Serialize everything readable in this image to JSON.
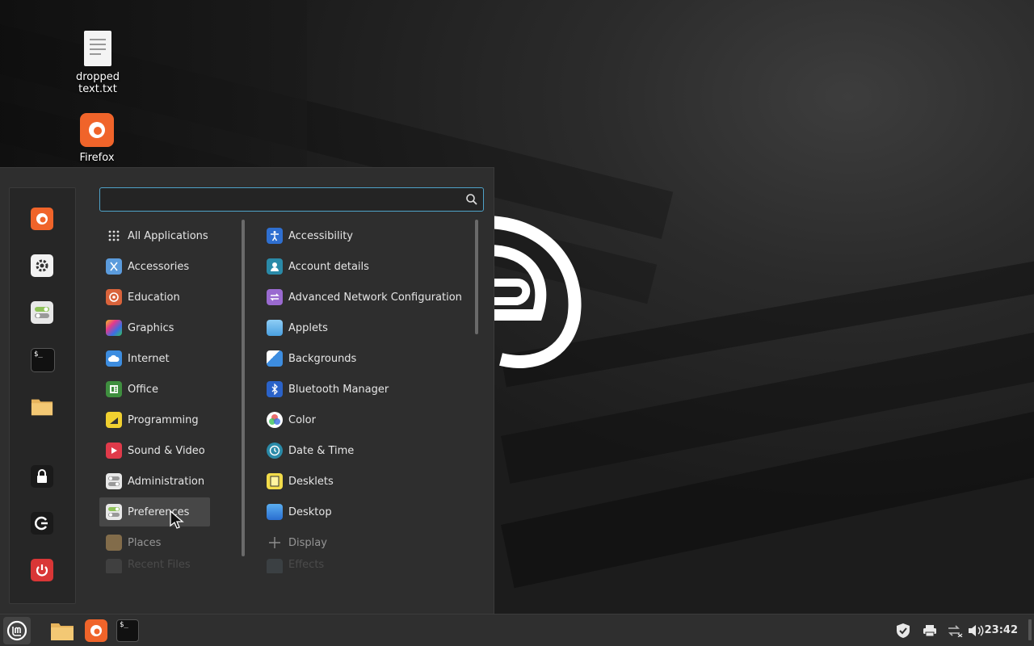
{
  "desktop": {
    "icons": [
      {
        "label": "dropped text.txt"
      },
      {
        "label": "Firefox"
      }
    ]
  },
  "menu": {
    "search": {
      "value": "",
      "placeholder": ""
    },
    "favorites": [
      "firefox-icon",
      "settings-icon",
      "toggles-icon",
      "terminal-icon",
      "folder-icon",
      "lock-icon",
      "logout-icon",
      "power-icon"
    ],
    "categories": [
      {
        "label": "All Applications"
      },
      {
        "label": "Accessories"
      },
      {
        "label": "Education"
      },
      {
        "label": "Graphics"
      },
      {
        "label": "Internet"
      },
      {
        "label": "Office"
      },
      {
        "label": "Programming"
      },
      {
        "label": "Sound & Video"
      },
      {
        "label": "Administration"
      },
      {
        "label": "Preferences",
        "selected": true
      },
      {
        "label": "Places"
      },
      {
        "label": "Recent Files"
      }
    ],
    "apps": [
      {
        "label": "Accessibility"
      },
      {
        "label": "Account details"
      },
      {
        "label": "Advanced Network Configuration"
      },
      {
        "label": "Applets"
      },
      {
        "label": "Backgrounds"
      },
      {
        "label": "Bluetooth Manager"
      },
      {
        "label": "Color"
      },
      {
        "label": "Date & Time"
      },
      {
        "label": "Desklets"
      },
      {
        "label": "Desktop"
      },
      {
        "label": "Display"
      },
      {
        "label": "Effects"
      }
    ]
  },
  "taskbar": {
    "clock": "23:42"
  },
  "colors": {
    "accent": "#4fa3c9",
    "mint": "#8fc25a",
    "firefox": "#f0642a"
  }
}
